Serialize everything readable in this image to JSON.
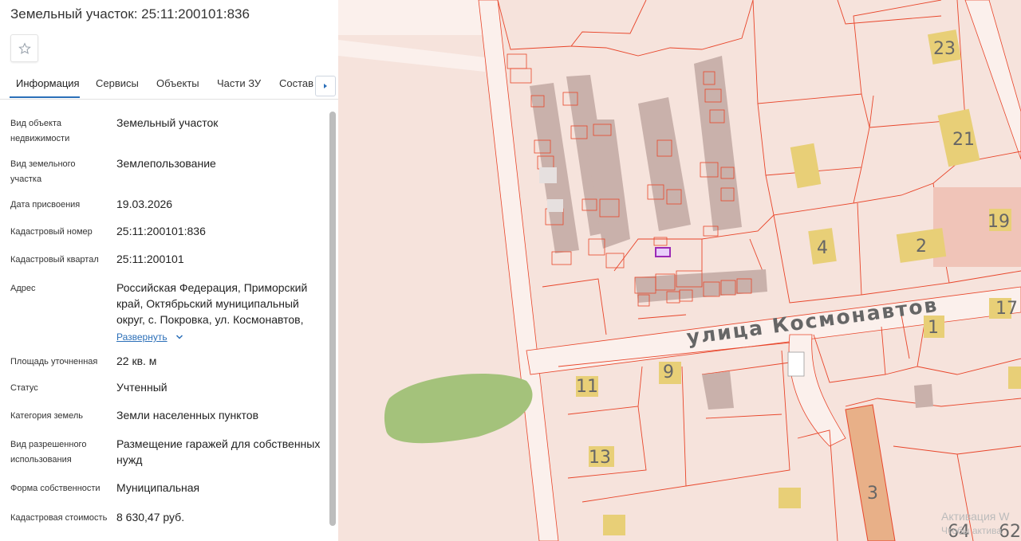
{
  "panel": {
    "title": "Земельный участок: 25:11:200101:836",
    "tabs": [
      "Информация",
      "Сервисы",
      "Объекты",
      "Части ЗУ",
      "Состав"
    ],
    "active_tab": "Информация",
    "fields": [
      {
        "label": "Вид объекта недвижимости",
        "value": "Земельный участок"
      },
      {
        "label": "Вид земельного участка",
        "value": "Землепользование"
      },
      {
        "label": "Дата присвоения",
        "value": "19.03.2026"
      },
      {
        "label": "Кадастровый номер",
        "value": "25:11:200101:836"
      },
      {
        "label": "Кадастровый квартал",
        "value": "25:11:200101"
      },
      {
        "label": "Адрес",
        "value": "Российская Федерация, Приморский край, Октябрьский муниципальный округ, с. Покровка, ул. Космонавтов,",
        "expand_label": "Развернуть"
      },
      {
        "label": "Площадь уточненная",
        "value": "22 кв. м"
      },
      {
        "label": "Статус",
        "value": "Учтенный"
      },
      {
        "label": "Категория земель",
        "value": "Земли населенных пунктов"
      },
      {
        "label": "Вид разрешенного использования",
        "value": "Размещение гаражей для собственных нужд"
      },
      {
        "label": "Форма собственности",
        "value": "Муниципальная"
      },
      {
        "label": "Кадастровая стоимость",
        "value": "8 630,47 руб."
      }
    ]
  },
  "map": {
    "street_name": "улица Космонавтов",
    "house_numbers": [
      "23",
      "21",
      "19",
      "4",
      "2",
      "17",
      "1",
      "9",
      "11",
      "13",
      "3",
      "64",
      "62"
    ],
    "watermark_line1": "Активация W",
    "watermark_line2": "Чтобы актива"
  },
  "colors": {
    "map_background": "#f6e3dc",
    "parcel_border": "#e8452a",
    "building": "#c9b1ab",
    "house_label_bg": "#e8cf77",
    "selected_parcel": "#9b2ab6",
    "green_area": "#a4c27b",
    "road": "#fbf0ec",
    "accent": "#2b6fb8"
  },
  "icons": {
    "favorite": "star-icon",
    "tabs_next": "chevron-right-icon",
    "expand": "chevron-down-icon"
  }
}
